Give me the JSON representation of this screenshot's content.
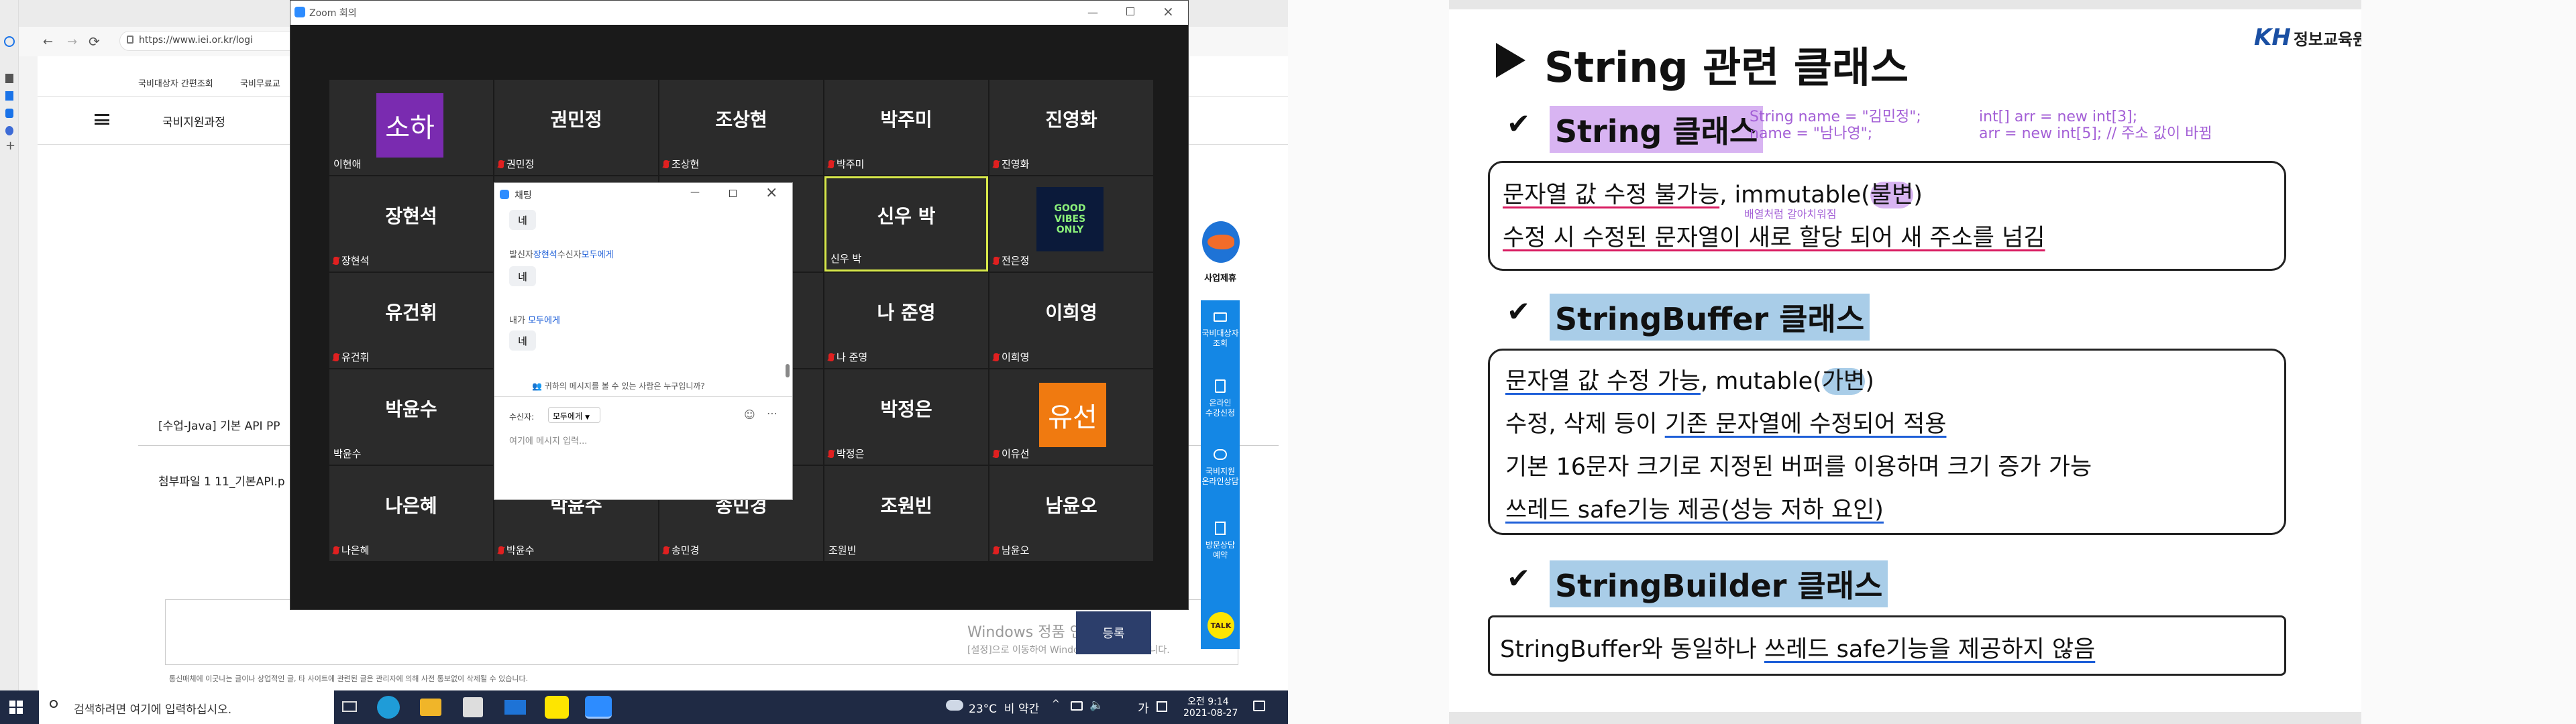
{
  "browser": {
    "url": "https://www.iei.or.kr/logi",
    "nav_items": [
      "국비대상자 간편조회",
      "국비무료교"
    ],
    "menu_label": "국비지원과정",
    "post_title": "[수업-Java] 기본 API PP",
    "attachment": "첨부파일 1  11_기본API.p",
    "notice": "통신매체에 이굿나는 글이나 상업적인 글, 타 사이트에 관련된 글은 관리자에 의해 사전 통보없이 삭제될 수 있습니다."
  },
  "zoom": {
    "title": "Zoom 회의",
    "tiles": [
      {
        "name": "소하",
        "sub": "이현애",
        "mic": false,
        "avatar": "소하",
        "avatar_color": "#7a2bb0"
      },
      {
        "name": "권민정",
        "sub": "권민정",
        "mic": true
      },
      {
        "name": "조상현",
        "sub": "조상현",
        "mic": true
      },
      {
        "name": "박주미",
        "sub": "박주미",
        "mic": true
      },
      {
        "name": "진영화",
        "sub": "진영화",
        "mic": true
      },
      {
        "name": "장현석",
        "sub": "장현석",
        "mic": true
      },
      {
        "name": "",
        "sub": "",
        "mic": false
      },
      {
        "name": "",
        "sub": "",
        "mic": false
      },
      {
        "name": "신우 박",
        "sub": "신우 박",
        "mic": false,
        "active": true
      },
      {
        "name": "",
        "sub": "전은정",
        "mic": true,
        "image": "GOOD VIBES ONLY"
      },
      {
        "name": "유건휘",
        "sub": "유건휘",
        "mic": true
      },
      {
        "name": "",
        "sub": "",
        "mic": false
      },
      {
        "name": "",
        "sub": "",
        "mic": false
      },
      {
        "name": "나 준영",
        "sub": "나 준영",
        "mic": true
      },
      {
        "name": "이희영",
        "sub": "이희영",
        "mic": true
      },
      {
        "name": "박윤수",
        "sub": "박윤수",
        "mic": false
      },
      {
        "name": "",
        "sub": "",
        "mic": false
      },
      {
        "name": "",
        "sub": "",
        "mic": false
      },
      {
        "name": "박정은",
        "sub": "박정은",
        "mic": true
      },
      {
        "name": "유선",
        "sub": "이유선",
        "mic": true,
        "avatar": "유선",
        "avatar_color": "#f07a10"
      },
      {
        "name": "나은혜",
        "sub": "나은혜",
        "mic": true
      },
      {
        "name": "박윤수",
        "sub": "박윤수",
        "mic": true
      },
      {
        "name": "송민경",
        "sub": "송민경",
        "mic": true
      },
      {
        "name": "조원빈",
        "sub": "조원빈",
        "mic": false
      },
      {
        "name": "남윤오",
        "sub": "남윤오",
        "mic": true
      }
    ],
    "chat": {
      "title": "채팅",
      "msg1": "네",
      "from2_prefix": "발신자",
      "from2_name": "장현석",
      "from2_mid": "수신자",
      "from2_to": "모두에게",
      "msg2": "네",
      "from3_prefix": "내가",
      "from3_to": "모두에게",
      "msg3": "네",
      "privacy": "귀하의 메시지를 볼 수 있는 사람은 누구입니까?",
      "to_label": "수신자:",
      "to_value": "모두에게",
      "placeholder": "여기에 메시지 입력..."
    }
  },
  "sidebar_right": {
    "logo_label": "사업제휴",
    "items": [
      "국비대상자\n조회",
      "온라인\n수강신청",
      "국비지원\n온라인상담",
      "방문상담\n예약"
    ],
    "talk": "TALK"
  },
  "windows_activation": {
    "line1": "Windows 정품 인증",
    "line2": "[설정]으로 이동하여 Windows를 정품 인증합니다."
  },
  "register_btn": "등록",
  "taskbar": {
    "search_placeholder": "검색하려면 여기에 입력하십시오.",
    "weather": "23°C  비 약간",
    "ime": "가",
    "time": "오전 9:14",
    "date": "2021-08-27"
  },
  "slide": {
    "title": "String 관련 클래스",
    "logo_kh": "KH",
    "logo_text": "정보교육원",
    "sec1": {
      "head": "String 클래스",
      "code1a": "String name = \"김민정\";",
      "code1b": "name = \"남나영\";",
      "code2a": "int[] arr = new int[3];",
      "code2b": "arr = new int[5];  // 주소 값이 바뀜",
      "line1_a": "문자열 값 수정 불가능",
      "line1_b": ", immutable(",
      "line1_c": "불변",
      "line1_d": ")",
      "note": "배열처럼 갈아치워짐",
      "line2": "수정 시 수정된 문자열이 새로 할당 되어 새 주소를 넘김"
    },
    "sec2": {
      "head": "StringBuffer 클래스",
      "line1_a": "문자열 값 수정 가능",
      "line1_b": ", mutable(",
      "line1_c": "가변",
      "line1_d": ")",
      "line2_a": "수정, 삭제 등이 ",
      "line2_b": "기존 문자열에 수정되어 적용",
      "line3": "기본 16문자 크기로 지정된 버퍼를 이용하며 크기 증가 가능",
      "line4_a": "쓰레드 safe기능 제공(성능 저하 요인)"
    },
    "sec3": {
      "head": "StringBuilder 클래스",
      "line1_a": "StringBuffer와 동일하나 ",
      "line1_b": "쓰레드 safe기능을 제공하지 않음"
    }
  }
}
